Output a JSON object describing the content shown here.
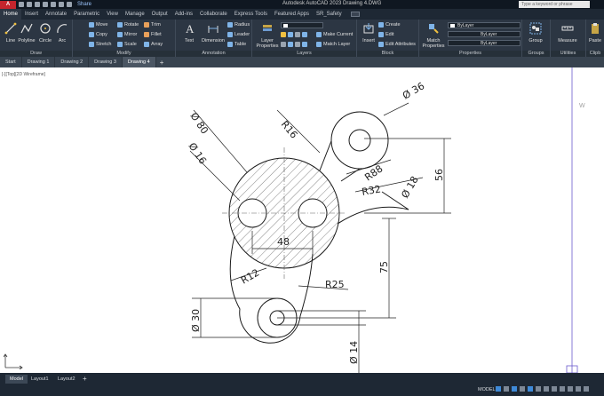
{
  "app": {
    "logo_text": "A CAD",
    "title": "Autodesk AutoCAD 2023    Drawing 4.DWG",
    "share_label": "Share",
    "search_placeholder": "Type a keyword or phrase"
  },
  "ribbon_tabs": [
    "Home",
    "Insert",
    "Annotate",
    "Parametric",
    "View",
    "Manage",
    "Output",
    "Add-ins",
    "Collaborate",
    "Express Tools",
    "Featured Apps",
    "SR_Safety"
  ],
  "ribbon": {
    "draw": {
      "title": "Draw",
      "line": "Line",
      "polyline": "Polyline",
      "circle": "Circle",
      "arc": "Arc"
    },
    "modify": {
      "title": "Modify",
      "move": "Move",
      "rotate": "Rotate",
      "trim": "Trim",
      "copy": "Copy",
      "mirror": "Mirror",
      "fillet": "Fillet",
      "stretch": "Stretch",
      "scale": "Scale",
      "array": "Array"
    },
    "annotation": {
      "title": "Annotation",
      "text": "Text",
      "dimension": "Dimension",
      "radius": "Radius",
      "leader": "Leader",
      "table": "Table"
    },
    "layers": {
      "title": "Layers",
      "layer_properties": "Layer Properties",
      "make_current": "Make Current",
      "match_layer": "Match Layer"
    },
    "block": {
      "title": "Block",
      "insert": "Insert",
      "create": "Create",
      "edit": "Edit",
      "edit_attributes": "Edit Attributes"
    },
    "properties": {
      "title": "Properties",
      "match_properties": "Match Properties",
      "color": "ByLayer",
      "linetype": "ByLayer",
      "lineweight": "ByLayer"
    },
    "groups": {
      "title": "Groups",
      "group": "Group"
    },
    "utilities": {
      "title": "Utilities",
      "measure": "Measure"
    },
    "clipboard": {
      "title": "Clipb",
      "paste": "Paste"
    }
  },
  "doc_tabs": [
    "Start",
    "Drawing 1",
    "Drawing 2",
    "Drawing 3",
    "Drawing 4"
  ],
  "active_doc_tab": "Drawing 4",
  "view_label": "[-][Top][2D Wireframe]",
  "viewcube_label": "W",
  "dimensions": {
    "d80": "Ø 80",
    "d16": "Ø 16",
    "d36": "Ø 36",
    "r16": "R16",
    "r88": "R88",
    "d18": "Ø 18",
    "r32": "R32",
    "d56": "56",
    "d48": "48",
    "d75": "75",
    "r25": "R25",
    "r12": "R12",
    "d30": "Ø 30",
    "d14": "Ø 14"
  },
  "layout_tabs": [
    "Model",
    "Layout1",
    "Layout2"
  ],
  "status": {
    "model": "MODEL"
  }
}
